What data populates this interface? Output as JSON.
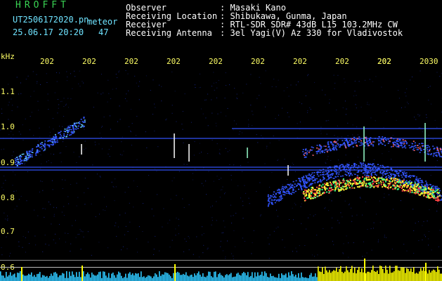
{
  "header": {
    "logo": "HROFFT",
    "filename": "UT2506172020.pn",
    "filename_suffix": "meteor",
    "datetime": "25.06.17 20:20",
    "count": "47",
    "observer_label": "Observer",
    "observer_value": ": Masaki Kano",
    "location_label": "Receiving Location",
    "location_value": ": Shibukawa, Gunma, Japan",
    "receiver_label": "Receiver",
    "receiver_value": ": RTL-SDR SDR# 43dB L15 103.2MHz CW",
    "antenna_label": "Receiving Antenna",
    "antenna_value": ": 3el Yagi(V) Az 330 for Vladivostok"
  },
  "axes": {
    "y_unit": "kHz",
    "x_ticks": [
      "2020",
      "2021",
      "2022",
      "2023",
      "2024",
      "2025",
      "2026",
      "2027",
      "2028",
      "2029",
      "2030"
    ],
    "x_tick_texts": [
      "202",
      "202",
      "202",
      "202",
      "202",
      "202",
      "202",
      "202",
      "202",
      "202",
      "2030"
    ],
    "y_ticks": [
      "1.1",
      "1.0",
      "0.9",
      "0.8",
      "0.7",
      "0.6"
    ],
    "y_tick_values": [
      1.1,
      1.0,
      0.9,
      0.8,
      0.7,
      0.6
    ]
  },
  "colors": {
    "background": "#000000",
    "tick_text": "#ffff66",
    "logo": "#39d353",
    "header_cyan": "#6fe3ff",
    "trace_blue": "#3355ff",
    "trace_hot": "#ffee33",
    "bar_cyan": "#2ec8ff",
    "bar_yellow": "#ffff00"
  }
}
